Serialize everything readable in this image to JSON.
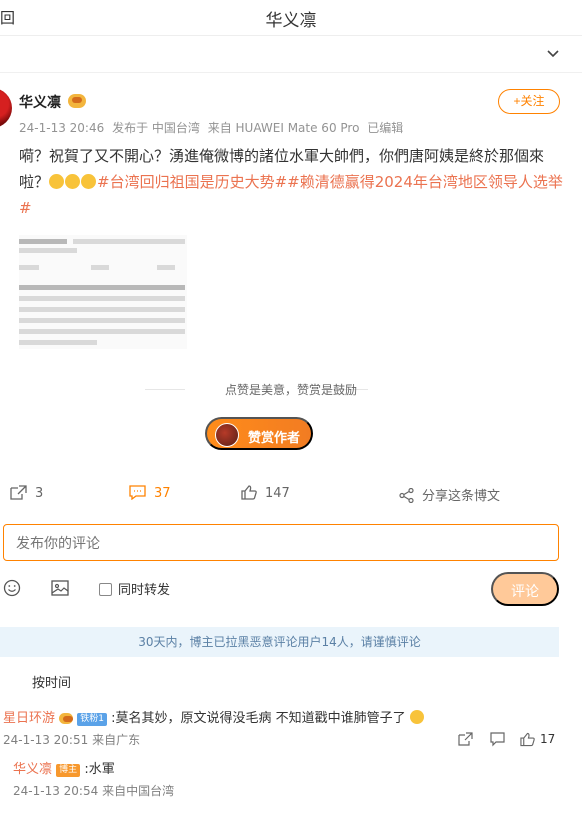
{
  "header": {
    "back_label": "回",
    "title": "华义凛"
  },
  "post": {
    "author": "华义凛",
    "follow_label": "+关注",
    "timestamp": "24-1-13 20:46",
    "published_from": "发布于 中国台湾",
    "device": "来自 HUAWEI Mate 60 Pro",
    "edited_label": "已编辑",
    "text": "嗬？祝賀了又不開心？湧進俺微博的諸位水軍大帥們，你們唐阿姨是終於那個來啦？",
    "tags": "#台湾回归祖国是历史大势##赖清德赢得2024年台湾地区领导人选举#"
  },
  "reward": {
    "caption": "点赞是美意，赞赏是鼓励",
    "button_label": "赞赏作者"
  },
  "actions": {
    "repost_count": "3",
    "comment_count": "37",
    "like_count": "147",
    "share_label": "分享这条博文"
  },
  "comment_form": {
    "placeholder": "发布你的评论",
    "forward_label": "同时转发",
    "submit_label": "评论"
  },
  "notice": "30天内，博主已拉黑恶意评论用户14人，请谨慎评论",
  "sort_label": "按时间",
  "comments": [
    {
      "author": "星日环游",
      "badge": "铁粉1",
      "text": ":莫名其妙，原文说得没毛病 不知道戳中谁肺管子了",
      "timestamp": "24-1-13 20:51",
      "location": "来自广东",
      "like_count": "17"
    }
  ],
  "reply": {
    "author": "华义凛",
    "badge": "博主",
    "text": ":水軍",
    "timestamp": "24-1-13 20:54",
    "location": "来自中国台湾"
  },
  "colors": {
    "accent": "#ff8200",
    "tag": "#eb7350",
    "notice_bg": "#eaf4fb"
  }
}
